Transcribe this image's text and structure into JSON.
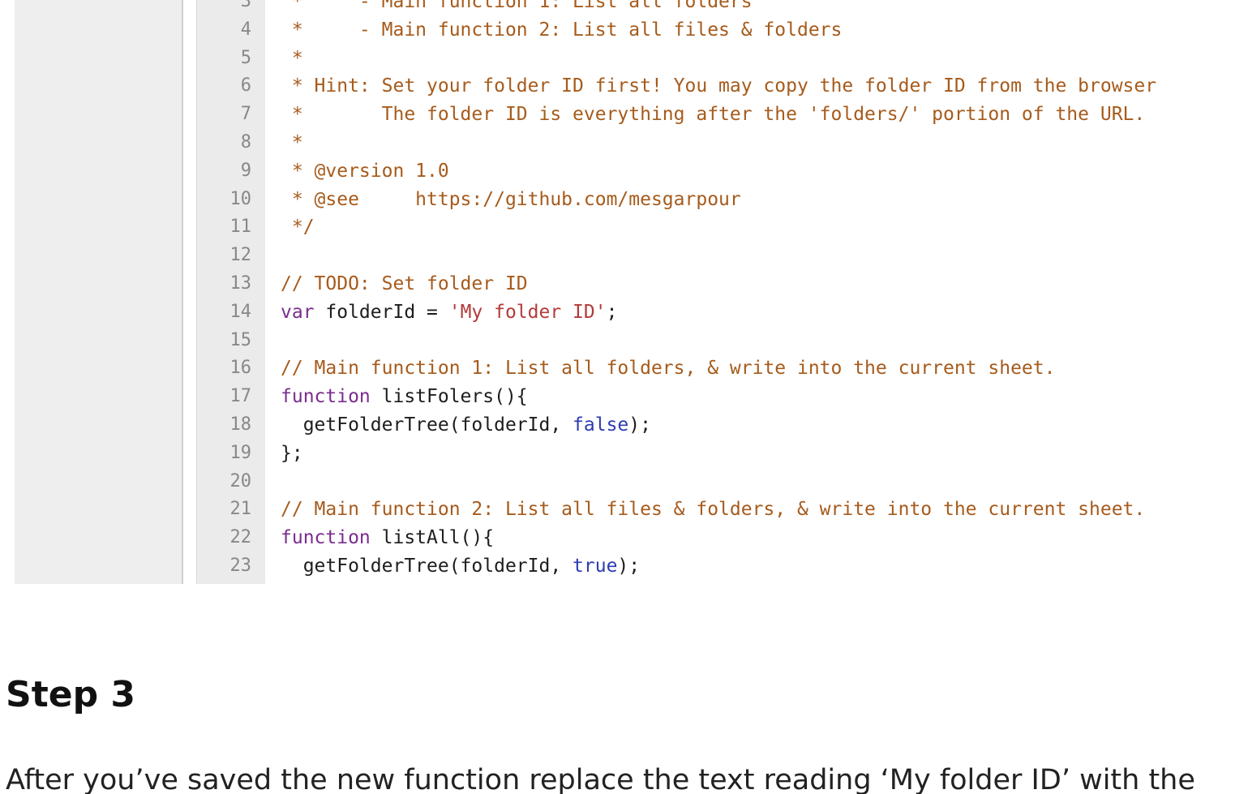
{
  "editor": {
    "line_numbers": [
      "3",
      "4",
      "5",
      "6",
      "7",
      "8",
      "9",
      "10",
      "11",
      "12",
      "13",
      "14",
      "15",
      "16",
      "17",
      "18",
      "19",
      "20",
      "21",
      "22",
      "23"
    ],
    "code": [
      {
        "text": " *     - Main function 1: List all folders",
        "type": "comment"
      },
      {
        "text": " *     - Main function 2: List all files & folders",
        "type": "comment"
      },
      {
        "text": " *",
        "type": "comment"
      },
      {
        "text": " * Hint: Set your folder ID first! You may copy the folder ID from the browser",
        "type": "comment"
      },
      {
        "text": " *       The folder ID is everything after the 'folders/' portion of the URL.",
        "type": "comment"
      },
      {
        "text": " *",
        "type": "comment"
      },
      {
        "text": " * @version 1.0",
        "type": "comment"
      },
      {
        "text": " * @see     https://github.com/mesgarpour",
        "type": "comment"
      },
      {
        "text": " */",
        "type": "comment"
      },
      {
        "text": "",
        "type": "plain"
      },
      {
        "text": "// TODO: Set folder ID",
        "type": "comment"
      },
      {
        "type": "mixed",
        "parts": [
          {
            "text": "var",
            "type": "keyword"
          },
          {
            "text": " folderId = ",
            "type": "plain"
          },
          {
            "text": "'My folder ID'",
            "type": "string"
          },
          {
            "text": ";",
            "type": "plain"
          }
        ]
      },
      {
        "text": "",
        "type": "plain"
      },
      {
        "text": "// Main function 1: List all folders, & write into the current sheet.",
        "type": "comment"
      },
      {
        "type": "mixed",
        "parts": [
          {
            "text": "function",
            "type": "keyword"
          },
          {
            "text": " listFolers(){",
            "type": "plain"
          }
        ]
      },
      {
        "type": "mixed",
        "parts": [
          {
            "text": "  getFolderTree(folderId, ",
            "type": "plain"
          },
          {
            "text": "false",
            "type": "bool"
          },
          {
            "text": ");",
            "type": "plain"
          }
        ]
      },
      {
        "text": "};",
        "type": "plain"
      },
      {
        "text": "",
        "type": "plain"
      },
      {
        "text": "// Main function 2: List all files & folders, & write into the current sheet.",
        "type": "comment"
      },
      {
        "type": "mixed",
        "parts": [
          {
            "text": "function",
            "type": "keyword"
          },
          {
            "text": " listAll(){",
            "type": "plain"
          }
        ]
      },
      {
        "type": "mixed",
        "parts": [
          {
            "text": "  getFolderTree(folderId, ",
            "type": "plain"
          },
          {
            "text": "true",
            "type": "bool"
          },
          {
            "text": ");",
            "type": "plain"
          }
        ]
      }
    ]
  },
  "article": {
    "step_heading": "Step 3",
    "instruction": "After you’ve saved the new function replace the text reading ‘My folder ID’ with the"
  }
}
